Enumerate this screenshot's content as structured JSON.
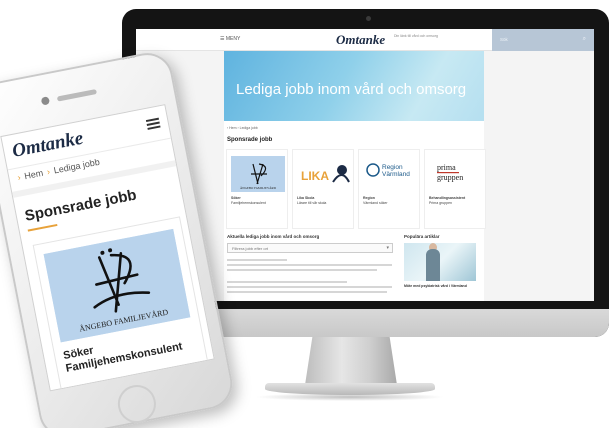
{
  "desktop": {
    "header": {
      "menu_label": "☰ MENY",
      "logo": "Omtanke",
      "tagline": "Din länk till vård och omsorg",
      "search_placeholder": "Sök"
    },
    "hero_title": "Lediga jobb inom vård och omsorg",
    "breadcrumb": "› Hem › Lediga jobb",
    "sponsored_title": "Sponsrade jobb",
    "cards": [
      {
        "logo": "ÄF",
        "logo_sub": "ÅNGEBO FAMILJEVÅRD",
        "title": "Söker",
        "subtitle": "Familjehemskonsulent"
      },
      {
        "logo": "LIKA",
        "title": "Lika Skola",
        "subtitle": "Lärare till vår skola"
      },
      {
        "logo": "Region Värmland",
        "title": "Region",
        "subtitle": "Värmland söker"
      },
      {
        "logo": "prima gruppen",
        "title": "Behandlingsassistent",
        "subtitle": "Prima gruppen"
      }
    ],
    "filter_title": "Aktuella lediga jobb inom vård och omsorg",
    "filter_select": "Filtrera jobb efter ort",
    "popular_title": "Populära artiklar",
    "popular_article": "Möte med psykiatrisk vård i Värmland"
  },
  "mobile": {
    "logo": "Omtanke",
    "breadcrumb_home": "Hem",
    "breadcrumb_current": "Lediga jobb",
    "title": "Sponsrade jobb",
    "card_logo": "ÄF",
    "card_logo_sub": "ÅNGEBO FAMILJEVÅRD",
    "card_title": "Söker Familjehemskonsulent"
  },
  "colors": {
    "hero": "#5fb3df",
    "accent": "#e8a23a",
    "logo_navy": "#1c2b45",
    "card_logo_bg": "#b9d3ec"
  }
}
